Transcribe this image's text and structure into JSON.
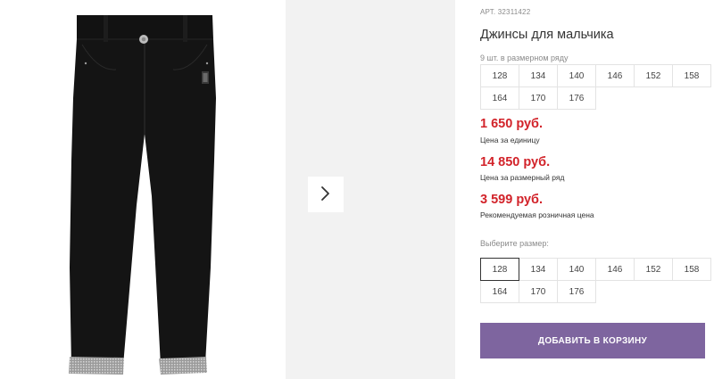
{
  "product": {
    "article_label": "АРТ. 32311422",
    "title": "Джинсы для мальчика",
    "set_note": "9 шт. в размерном ряду",
    "size_row_sizes": [
      "128",
      "134",
      "140",
      "146",
      "152",
      "158",
      "164",
      "170",
      "176"
    ]
  },
  "prices": [
    {
      "amount": "1 650 руб.",
      "note": "Цена за единицу"
    },
    {
      "amount": "14 850 руб.",
      "note": "Цена за размерный ряд"
    },
    {
      "amount": "3 599 руб.",
      "note": "Рекомендуемая розничная цена"
    }
  ],
  "size_selector": {
    "label": "Выберите размер:",
    "options": [
      "128",
      "134",
      "140",
      "146",
      "152",
      "158",
      "164",
      "170",
      "176"
    ],
    "selected": "128"
  },
  "actions": {
    "add_to_cart": "ДОБАВИТЬ В КОРЗИНУ"
  },
  "gallery": {
    "main_image_icon": "black-jeans-photo",
    "next_icon": "chevron-right-icon"
  },
  "colors": {
    "price": "#d2232a",
    "button": "#7e659f",
    "jeans": "#141414"
  }
}
